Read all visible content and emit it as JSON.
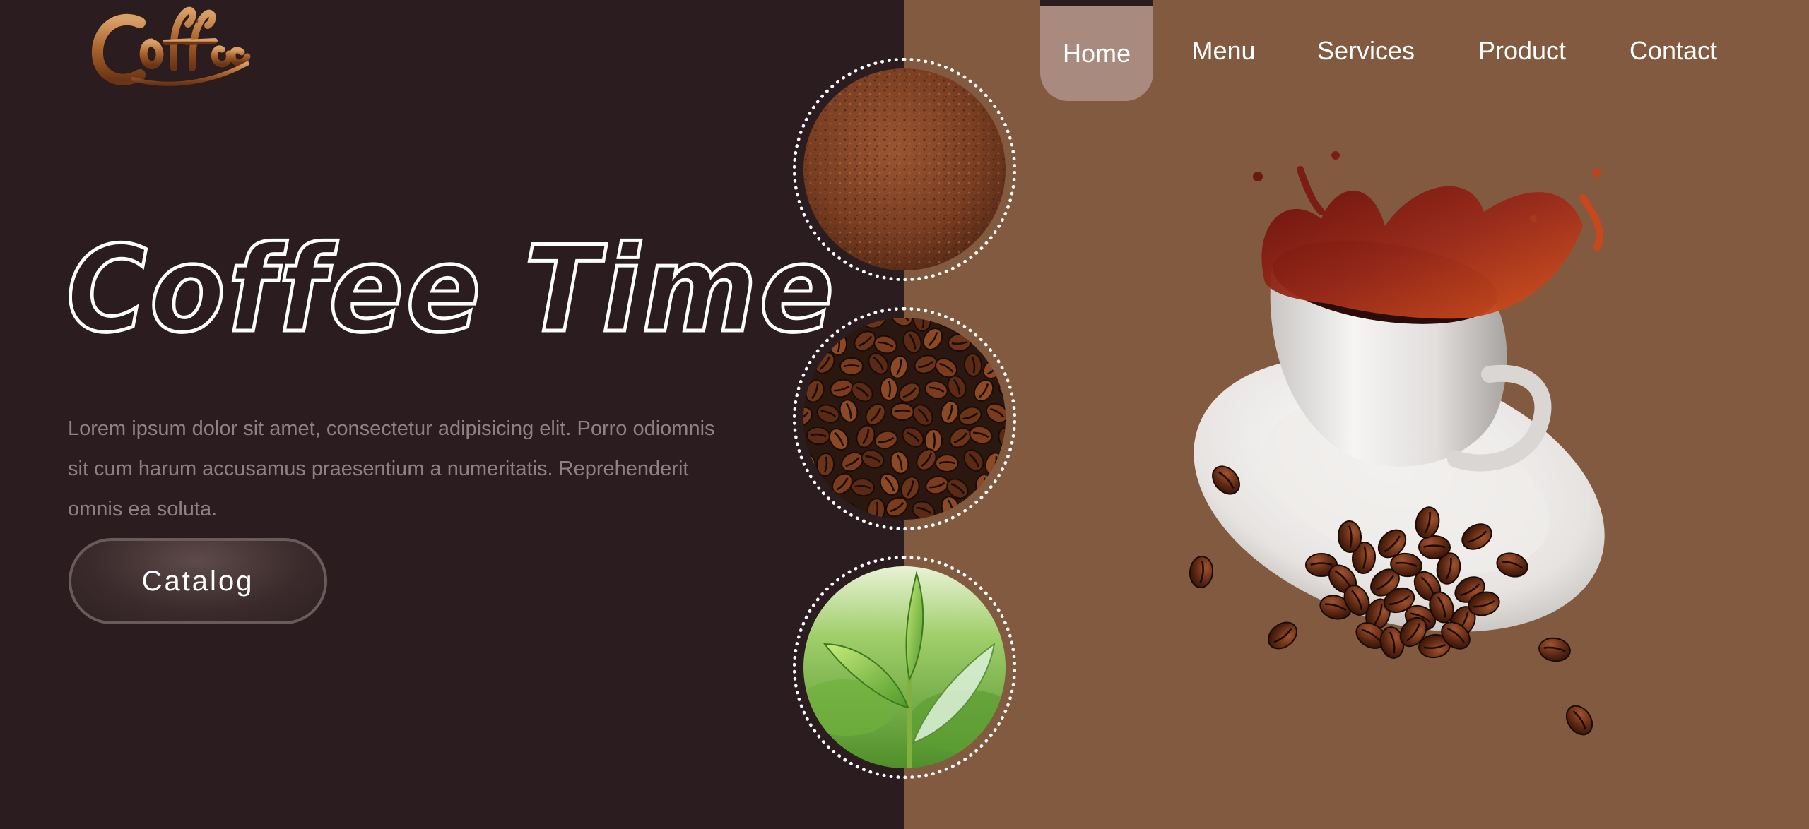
{
  "logo": {
    "text": "Coffee",
    "icon": "coffee-logo"
  },
  "nav": {
    "items": [
      {
        "label": "Home",
        "active": true
      },
      {
        "label": "Menu",
        "active": false
      },
      {
        "label": "Services",
        "active": false
      },
      {
        "label": "Product",
        "active": false
      },
      {
        "label": "Contact",
        "active": false
      }
    ]
  },
  "hero": {
    "title": "Coffee Time",
    "description": "Lorem ipsum dolor sit amet, consectetur adipisicing elit. Porro odiomnis sit cum harum accusamus praesentium a numeritatis. Reprehenderit omnis ea soluta.",
    "button_label": "Catalog",
    "image": "coffee-cup-splash-with-beans"
  },
  "circles": [
    {
      "image": "ground-coffee-thumbnail"
    },
    {
      "image": "coffee-beans-thumbnail"
    },
    {
      "image": "tea-leaves-thumbnail"
    }
  ],
  "colors": {
    "left_background": "#2b1d1f",
    "right_background": "#825a40",
    "active_nav": "#a88a7e",
    "text_muted": "#8d8183"
  }
}
